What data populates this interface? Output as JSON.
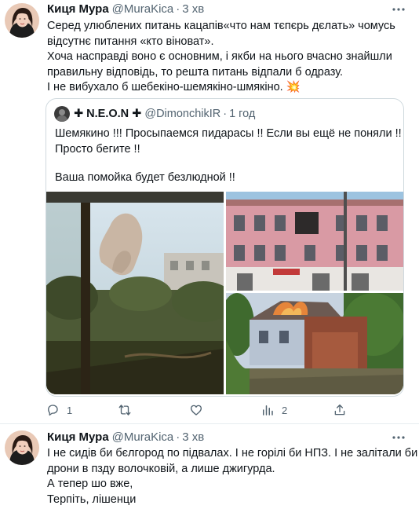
{
  "tweets": [
    {
      "author": {
        "name": "Киця Мура",
        "handle": "@MuraKica",
        "time": "3 хв"
      },
      "text_lines": [
        "Серед улюблених питань кацапів«что нам тєпєрь дєлать» чомусь",
        "відсутнє питання «кто віноват».",
        "Хоча насправді воно є основним, і якби на нього вчасно знайшли",
        "правильну відповідь, то решта питань відпали б одразу.",
        "І не вибухало б шебекіно-шемякіно-шмякіно. 💥"
      ],
      "quoted": {
        "name": "✚ N.E.O.N ✚",
        "handle": "@DimonchikIR",
        "time": "1 год",
        "lines": [
          "Шемякино !!! Просыпаемся пидарасы !! Если вы ещё не поняли !!",
          "Просто бегите !!",
          "",
          "Ваша помойка будет безлюдной !!"
        ]
      },
      "actions": {
        "reply": {
          "icon": "reply-icon",
          "count": "1"
        },
        "retweet": {
          "icon": "retweet-icon",
          "count": ""
        },
        "like": {
          "icon": "heart-icon",
          "count": ""
        },
        "stats": {
          "icon": "stats-icon",
          "count": "2"
        },
        "share": {
          "icon": "share-icon",
          "count": ""
        }
      }
    },
    {
      "author": {
        "name": "Киця Мура",
        "handle": "@MuraKica",
        "time": "3 хв"
      },
      "text_lines": [
        "І не сидів би бєлгород по підвалах. І не горілі би НПЗ. І не залітали би",
        "дрони в пзду волочковій, а лише джигурда.",
        "А тепер шо вже,",
        "Терпіть, лішенци"
      ]
    }
  ],
  "colors": {
    "text": "#0f1419",
    "secondary": "#536471",
    "border": "#cfd9de"
  }
}
